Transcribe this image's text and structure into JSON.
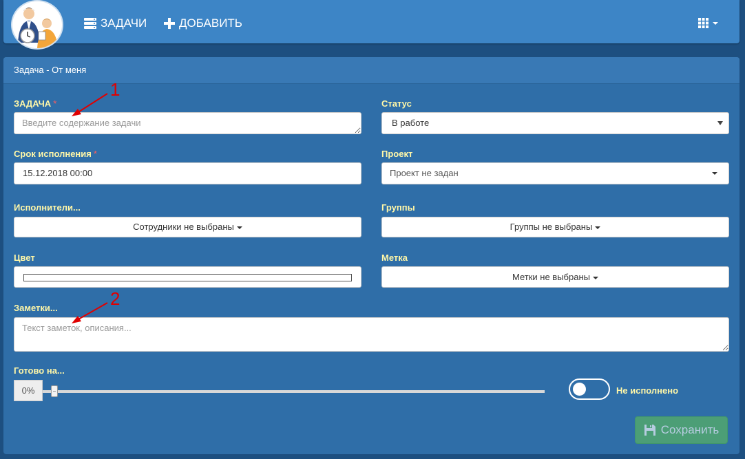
{
  "nav": {
    "tasks_label": "ЗАДАЧИ",
    "add_label": "ДОБАВИТЬ"
  },
  "panel": {
    "title": "Задача - От меня"
  },
  "form": {
    "task": {
      "label": "ЗАДАЧА",
      "required_mark": "*",
      "placeholder": "Введите содержание задачи",
      "value": ""
    },
    "status": {
      "label": "Статус",
      "value": "В работе"
    },
    "deadline": {
      "label": "Срок исполнения",
      "required_mark": "*",
      "value": "15.12.2018 00:00"
    },
    "project": {
      "label": "Проект",
      "value": "Проект не задан"
    },
    "executors": {
      "label": "Исполнители...",
      "value": "Сотрудники не выбраны"
    },
    "groups": {
      "label": "Группы",
      "value": "Группы не выбраны"
    },
    "color": {
      "label": "Цвет"
    },
    "tag": {
      "label": "Метка",
      "value": "Метки не выбраны"
    },
    "notes": {
      "label": "Заметки...",
      "placeholder": "Текст заметок, описания...",
      "value": ""
    },
    "progress": {
      "label": "Готово на...",
      "value_text": "0%",
      "value": 0
    },
    "done_toggle": {
      "label": "Не исполнено",
      "checked": false
    },
    "save_label": "Сохранить"
  },
  "annotations": [
    {
      "number": "1",
      "color": "#e00000"
    },
    {
      "number": "2",
      "color": "#e00000"
    }
  ],
  "colors": {
    "background": "#1d4f80",
    "navbar": "#3d85c6",
    "panel": "#2f6ea8",
    "label": "#fff7a8",
    "required": "#ff5c5c",
    "save_button": "#5cb85c"
  }
}
